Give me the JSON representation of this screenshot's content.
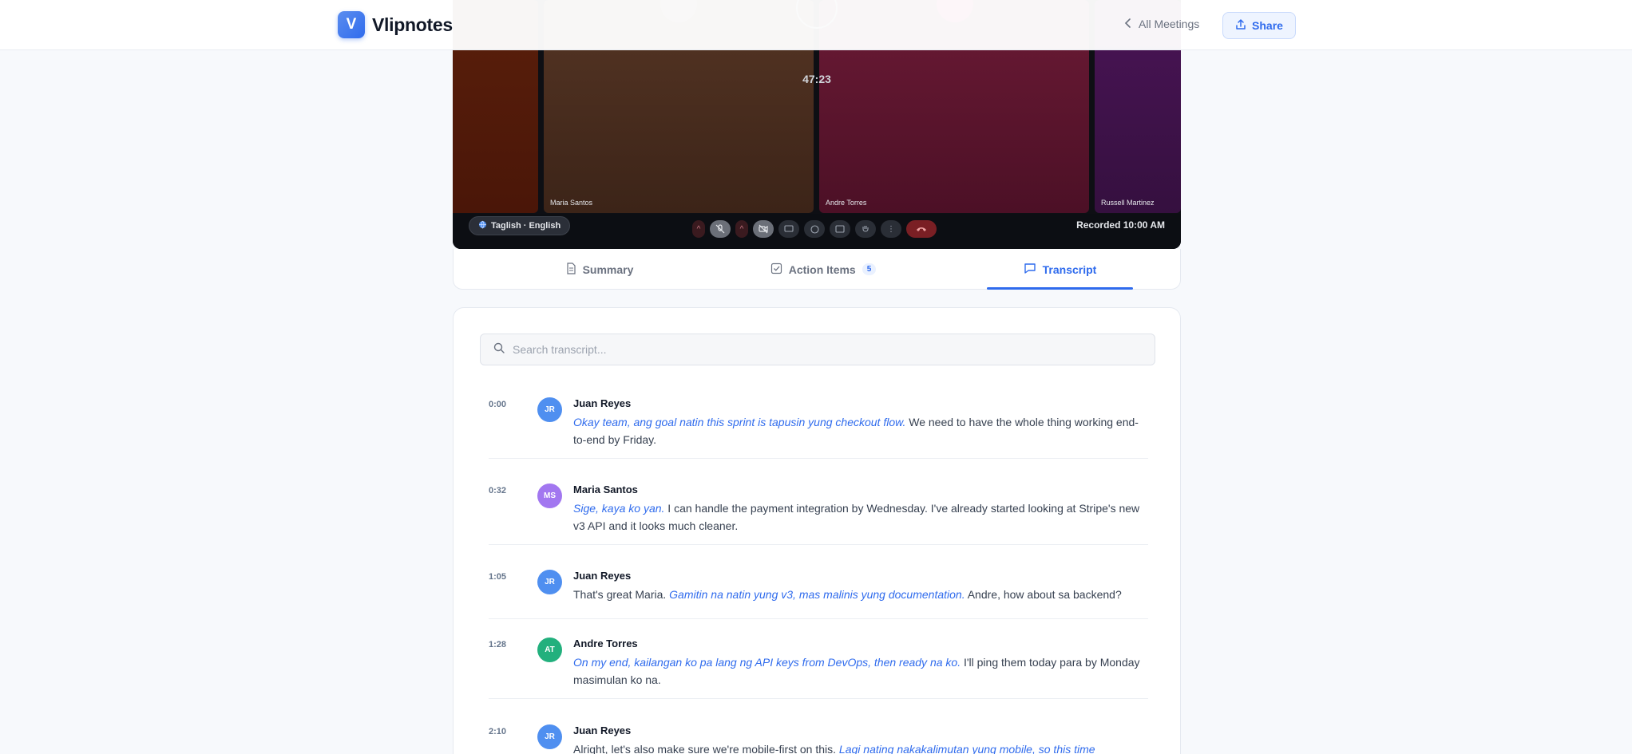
{
  "app": {
    "logo_letter": "V",
    "name": "Vlipnotes"
  },
  "header": {
    "all_meetings": "All Meetings",
    "share": "Share"
  },
  "video": {
    "timer": "47:23",
    "participants": [
      {
        "name": "",
        "color": "#5a1f0b"
      },
      {
        "name": "Maria Santos",
        "color": "#553524"
      },
      {
        "name": "Andre Torres",
        "color": "#6b1a35"
      },
      {
        "name": "Russell Martinez",
        "color": "#4a1456"
      }
    ],
    "language": "Taglish · English",
    "recorded": "Recorded 10:00 AM"
  },
  "tabs": {
    "summary": "Summary",
    "action_items": "Action Items",
    "action_items_count": "5",
    "transcript": "Transcript"
  },
  "transcript": {
    "search_placeholder": "Search transcript...",
    "entries": [
      {
        "time": "0:00",
        "initials": "JR",
        "speaker": "Juan Reyes",
        "color": "#4f8ff0",
        "segments": [
          {
            "t": "Okay team, ang goal natin this sprint is tapusin yung checkout flow.",
            "tl": true
          },
          {
            "t": " We need to have the whole thing working end-to-end by Friday.",
            "tl": false
          }
        ]
      },
      {
        "time": "0:32",
        "initials": "MS",
        "speaker": "Maria Santos",
        "color": "#a277f0",
        "segments": [
          {
            "t": "Sige, kaya ko yan.",
            "tl": true
          },
          {
            "t": " I can handle the payment integration by Wednesday. I've already started looking at Stripe's new v3 API and it looks much cleaner.",
            "tl": false
          }
        ]
      },
      {
        "time": "1:05",
        "initials": "JR",
        "speaker": "Juan Reyes",
        "color": "#4f8ff0",
        "segments": [
          {
            "t": "That's great Maria. ",
            "tl": false
          },
          {
            "t": "Gamitin na natin yung v3, mas malinis yung documentation.",
            "tl": true
          },
          {
            "t": " Andre, how about sa backend?",
            "tl": false
          }
        ]
      },
      {
        "time": "1:28",
        "initials": "AT",
        "speaker": "Andre Torres",
        "color": "#22b07d",
        "segments": [
          {
            "t": "On my end, kailangan ko pa lang ng API keys from DevOps, then ready na ko.",
            "tl": true
          },
          {
            "t": " I'll ping them today para by Monday masimulan ko na.",
            "tl": false
          }
        ]
      },
      {
        "time": "2:10",
        "initials": "JR",
        "speaker": "Juan Reyes",
        "color": "#4f8ff0",
        "segments": [
          {
            "t": "Alright, let's also make sure we're mobile-first on this. ",
            "tl": false
          },
          {
            "t": "Lagi nating nakakalimutan yung mobile, so this time",
            "tl": true
          }
        ]
      }
    ]
  }
}
